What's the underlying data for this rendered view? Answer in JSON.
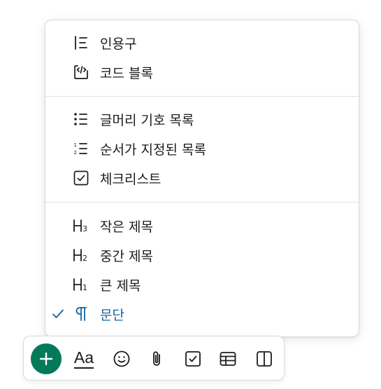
{
  "menu": {
    "groups": [
      {
        "items": [
          {
            "label": "인용구",
            "icon": "quote-icon",
            "selected": false
          },
          {
            "label": "코드 블록",
            "icon": "code-block-icon",
            "selected": false
          }
        ]
      },
      {
        "items": [
          {
            "label": "글머리 기호 목록",
            "icon": "bulleted-list-icon",
            "selected": false
          },
          {
            "label": "순서가 지정된 목록",
            "icon": "numbered-list-icon",
            "selected": false
          },
          {
            "label": "체크리스트",
            "icon": "checklist-icon",
            "selected": false
          }
        ]
      },
      {
        "items": [
          {
            "label": "작은 제목",
            "icon": "heading-3-icon",
            "selected": false
          },
          {
            "label": "중간 제목",
            "icon": "heading-2-icon",
            "selected": false
          },
          {
            "label": "큰 제목",
            "icon": "heading-1-icon",
            "selected": false
          },
          {
            "label": "문단",
            "icon": "paragraph-icon",
            "selected": true
          }
        ]
      }
    ]
  },
  "toolbar": {
    "items": [
      {
        "icon": "plus-icon"
      },
      {
        "icon": "text-format-icon",
        "text": "Aa"
      },
      {
        "icon": "emoji-icon"
      },
      {
        "icon": "attachment-icon"
      },
      {
        "icon": "checkbox-icon"
      },
      {
        "icon": "table-icon"
      },
      {
        "icon": "columns-icon"
      }
    ]
  },
  "colors": {
    "text": "#1d1c1d",
    "selected": "#1264a3",
    "plus_bg": "#007a5a",
    "divider": "#e1e1e1"
  }
}
